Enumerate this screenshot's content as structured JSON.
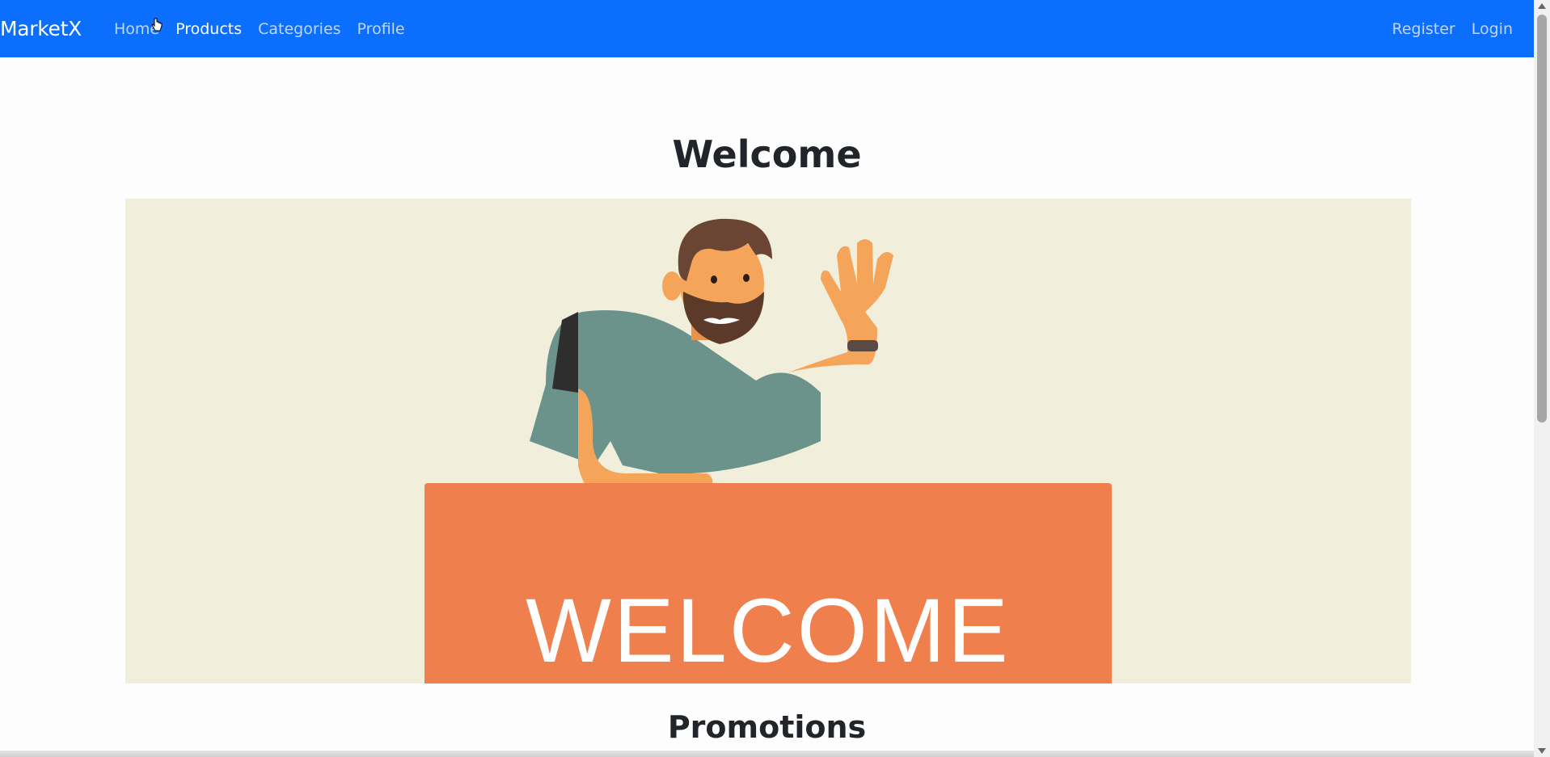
{
  "navbar": {
    "brand": "MarketX",
    "links": [
      "Home",
      "Products",
      "Categories",
      "Profile"
    ],
    "right_links": [
      "Register",
      "Login"
    ],
    "color": "#0b6efd"
  },
  "main": {
    "welcome_heading": "Welcome",
    "banner_text": "WELCOME",
    "promotions_heading": "Promotions"
  },
  "colors": {
    "banner_background": "#f1eedc",
    "sign": "#ef7f4d"
  }
}
